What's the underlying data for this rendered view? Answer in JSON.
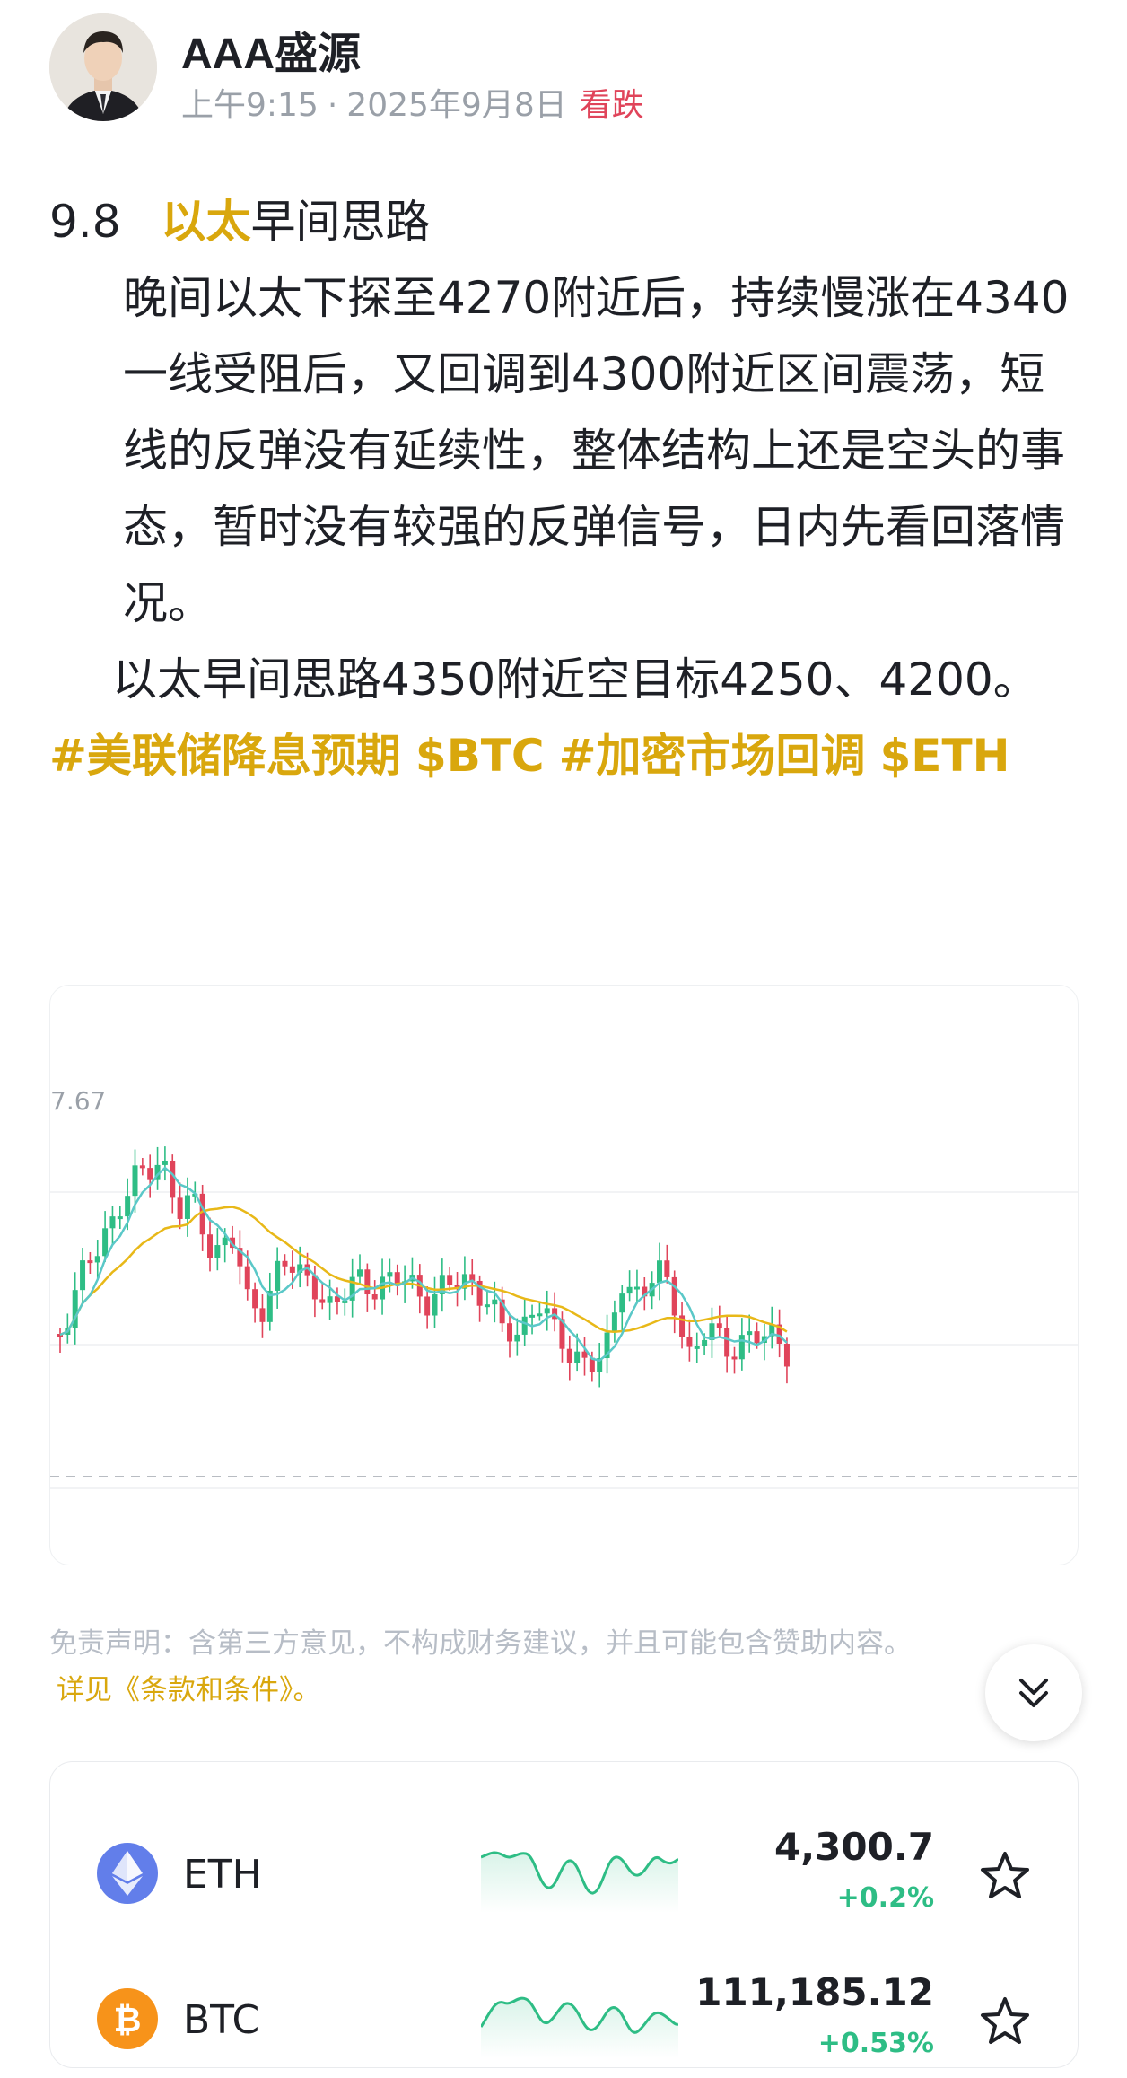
{
  "author": {
    "name": "AAA盛源",
    "time": "上午9:15",
    "separator": "·",
    "date": "2025年9月8日",
    "sentiment": "看跌",
    "sentiment_color": "#e0445a"
  },
  "post": {
    "title_date": "9.8",
    "title_highlight": "以太",
    "title_rest": "早间思路",
    "paragraph1": "晚间以太下探至4270附近后，持续慢涨在4340一线受阻后，又回调到4300附近区间震荡，短线的反弹没有延续性，整体结构上还是空头的事态，暂时没有较强的反弹信号，日内先看回落情况。",
    "paragraph2": "以太早间思路4350附近空目标4250、4200。",
    "tags": [
      "#美联储降息预期",
      "$BTC",
      "#加密市场回调",
      "$ETH"
    ]
  },
  "chart": {
    "price_label": "7.67",
    "up_color": "#2ebd85",
    "down_color": "#e0445a",
    "ma_fast_color": "#5ac8c8",
    "ma_slow_color": "#e8b818"
  },
  "disclaimer": {
    "text": "免责声明：含第三方意见，不构成财务建议，并且可能包含赞助内容。",
    "link": "详见《条款和条件》。"
  },
  "market": [
    {
      "symbol": "ETH",
      "price": "4,300.7",
      "change": "+0.2%",
      "icon": "ethereum-icon",
      "icon_color": "#627eea"
    },
    {
      "symbol": "BTC",
      "price": "111,185.12",
      "change": "+0.53%",
      "icon": "bitcoin-icon",
      "icon_color": "#f7931a"
    }
  ],
  "accent_color": "#d9a70d"
}
